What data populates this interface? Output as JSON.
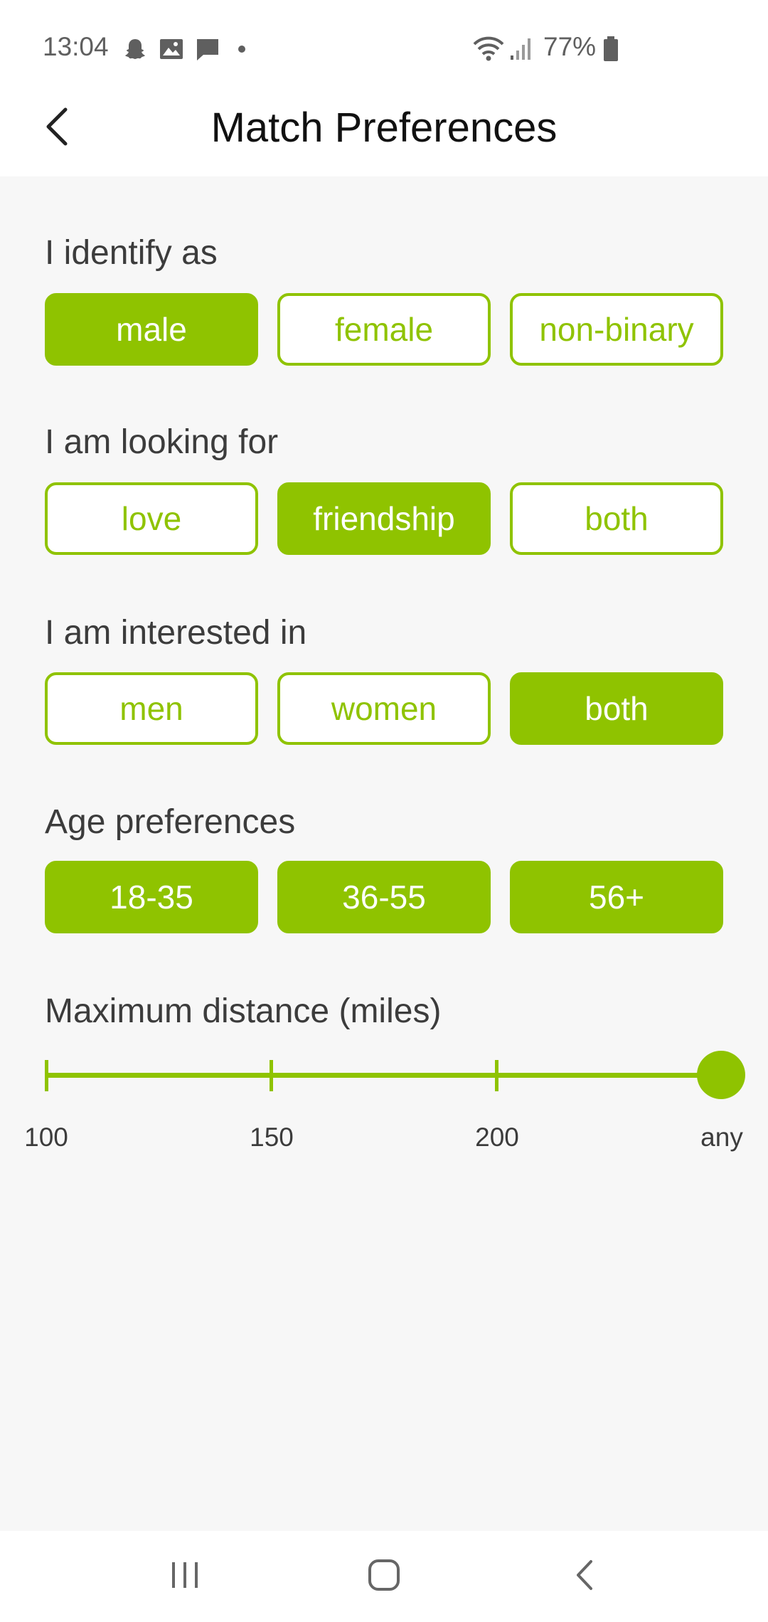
{
  "status_bar": {
    "time": "13:04",
    "battery": "77%",
    "notification_icons": [
      "snapchat-icon",
      "image-icon",
      "message-icon",
      "dot-icon"
    ],
    "system_icons": [
      "wifi-icon",
      "signal-icon",
      "battery-icon"
    ]
  },
  "header": {
    "title": "Match Preferences",
    "back_icon": "chevron-left-icon"
  },
  "sections": {
    "identify": {
      "label": "I identify as",
      "options": [
        "male",
        "female",
        "non-binary"
      ],
      "selected": [
        "male"
      ]
    },
    "looking_for": {
      "label": "I am looking for",
      "options": [
        "love",
        "friendship",
        "both"
      ],
      "selected": [
        "friendship"
      ]
    },
    "interested_in": {
      "label": "I am interested in",
      "options": [
        "men",
        "women",
        "both"
      ],
      "selected": [
        "both"
      ]
    },
    "age": {
      "label": "Age preferences",
      "options": [
        "18-35",
        "36-55",
        "56+"
      ],
      "selected": [
        "18-35",
        "36-55",
        "56+"
      ]
    }
  },
  "distance": {
    "label": "Maximum distance (miles)",
    "stops": [
      "100",
      "150",
      "200",
      "any"
    ],
    "selected": "any"
  },
  "nav_bar": {
    "icons": [
      "recent-apps-icon",
      "home-icon",
      "back-icon"
    ]
  },
  "colors": {
    "accent": "#8fc300",
    "background": "#f7f7f7",
    "label_text": "#3c3c3c",
    "title_text": "#111111"
  }
}
